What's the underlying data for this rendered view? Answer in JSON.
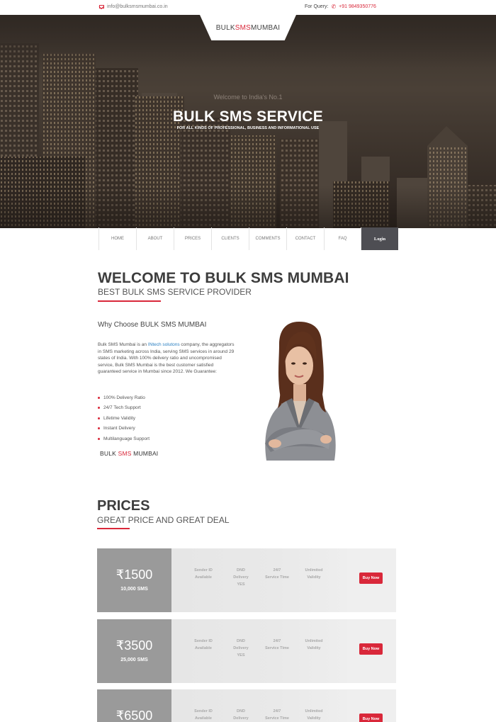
{
  "topbar": {
    "email": "info@bulksmsmumbai.co.in",
    "query_label": "For Query:",
    "phone": "+91 9849350776"
  },
  "logo": {
    "part1": "BULK ",
    "part2": "SMS",
    "part3": " MUMBAI"
  },
  "hero": {
    "welcome": "Welcome to India's No.1",
    "title": "BULK SMS SERVICE",
    "tagline": "FOR ALL KINDS OF PROFESSIONAL, BUSINESS AND INFORMATIONAL USE"
  },
  "nav": {
    "items": [
      "HOME",
      "ABOUT",
      "PRICES",
      "CLIENTS",
      "COMMENTS",
      "CONTACT",
      "FAQ"
    ],
    "login": "Login"
  },
  "welcome": {
    "title": "WELCOME TO BULK SMS MUMBAI",
    "subtitle": "BEST BULK SMS SERVICE PROVIDER",
    "why_title": "Why Choose BULK SMS MUMBAI",
    "about_pre": "Bulk SMS Mumbai is an ",
    "about_link": "INtech solutons",
    "about_post": " company, the aggregators in SMS marketing across India, serving SMS services in around 29 states of India. With 100% delivery ratio and uncompromised service, Bulk SMS Mumbai is the best customer satisfied guaranteed service in Mumbai since 2012. We Guarantee:",
    "guarantees": [
      "100% Delivery Ratio",
      "24/7 Tech Support",
      "Lifetime Validity",
      "Instant Delivery",
      "Multilanguage Support"
    ]
  },
  "prices": {
    "title": "PRICES",
    "subtitle": "GREAT PRICE AND GREAT DEAL",
    "plans": [
      {
        "amount": "₹1500",
        "sms": "10,000 SMS",
        "buy": "Buy Now"
      },
      {
        "amount": "₹3500",
        "sms": "25,000 SMS",
        "buy": "Buy Now"
      },
      {
        "amount": "₹6500",
        "sms": "",
        "buy": "Buy Now"
      }
    ],
    "features": {
      "sender_id": [
        "Sender ID",
        "Available"
      ],
      "dnd": [
        "DND",
        "Delivery",
        "YES"
      ],
      "support": [
        "24/7",
        "Service Time"
      ],
      "validity": [
        "Unlimited",
        "Validity"
      ]
    }
  },
  "colors": {
    "accent": "#d9283a",
    "login_bg": "#4e4e53",
    "price_bg": "#9a9a9a"
  }
}
